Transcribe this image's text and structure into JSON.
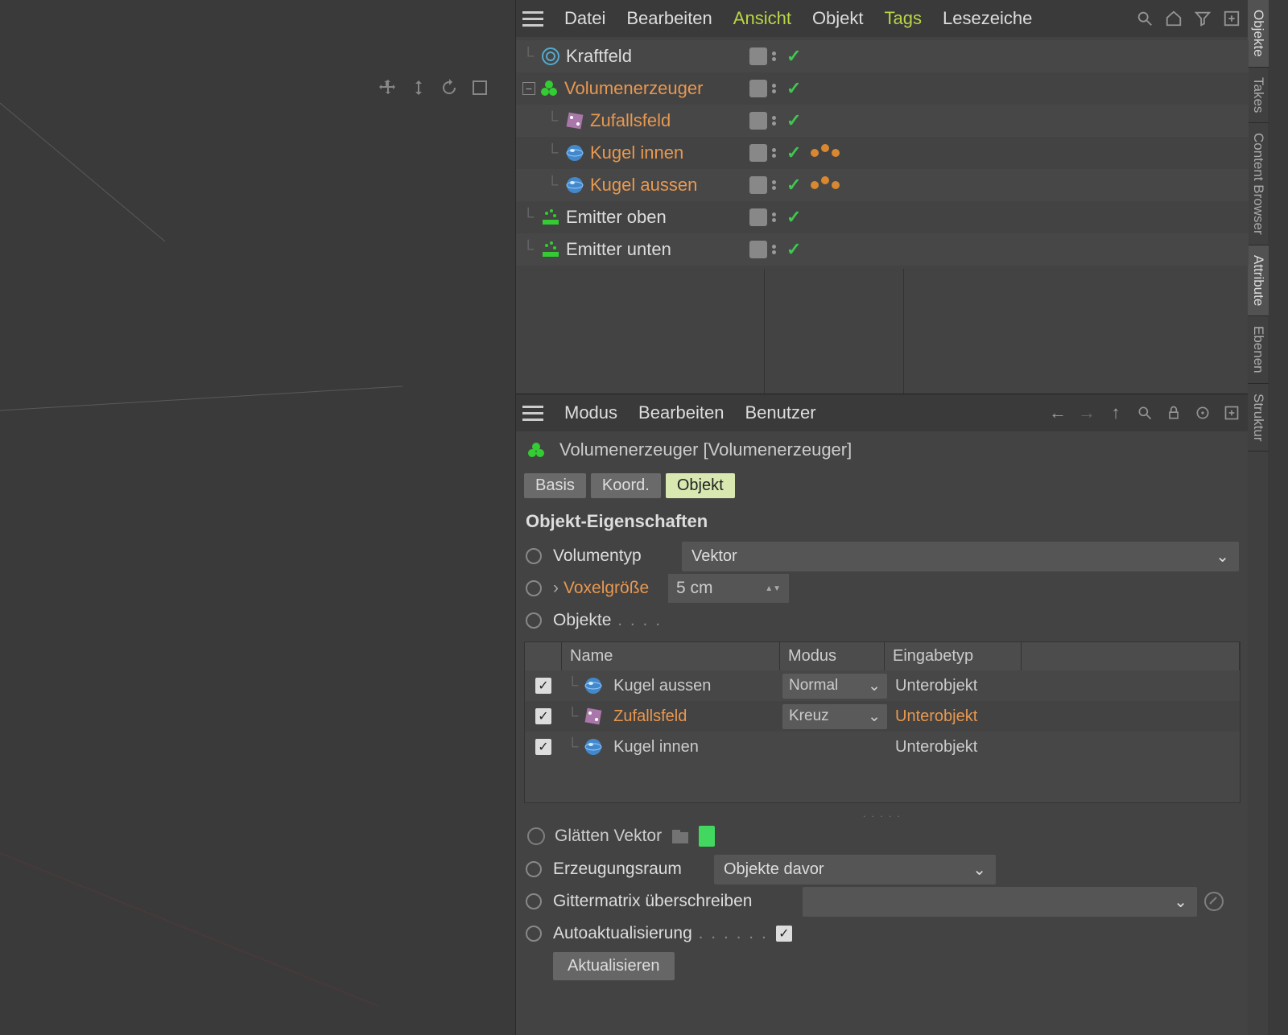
{
  "viewport_tools": [
    "move-icon",
    "updown-icon",
    "rotate-icon",
    "frame-icon"
  ],
  "side_tabs": [
    "Objekte",
    "Takes",
    "Content Browser",
    "Attribute",
    "Ebenen",
    "Struktur"
  ],
  "obj_menu": {
    "items": [
      "Datei",
      "Bearbeiten",
      "Ansicht",
      "Objekt",
      "Tags",
      "Lesezeiche"
    ],
    "highlight": [
      2,
      4
    ],
    "icons": [
      "search-icon",
      "home-icon",
      "filter-icon",
      "add-panel-icon"
    ]
  },
  "tree": [
    {
      "depth": 0,
      "icon": "field-icon",
      "label": "Kraftfeld",
      "cls": "white"
    },
    {
      "depth": 0,
      "icon": "volume-icon",
      "label": "Volumenerzeuger",
      "cls": "orange",
      "expanded": true
    },
    {
      "depth": 1,
      "icon": "random-icon",
      "label": "Zufallsfeld",
      "cls": "orange"
    },
    {
      "depth": 1,
      "icon": "sphere-icon",
      "label": "Kugel innen",
      "cls": "orange",
      "tags": true
    },
    {
      "depth": 1,
      "icon": "sphere-icon",
      "label": "Kugel aussen",
      "cls": "orange",
      "tags": true
    },
    {
      "depth": 0,
      "icon": "emitter-icon",
      "label": "Emitter oben",
      "cls": "white"
    },
    {
      "depth": 0,
      "icon": "emitter-icon",
      "label": "Emitter unten",
      "cls": "white"
    }
  ],
  "attr_menu": {
    "items": [
      "Modus",
      "Bearbeiten",
      "Benutzer"
    ],
    "icons": [
      "back-icon",
      "forward-icon",
      "up-icon",
      "search-icon",
      "lock-icon",
      "target-icon",
      "add-panel-icon"
    ]
  },
  "attr_header": {
    "icon": "volume-icon",
    "title": "Volumenerzeuger [Volumenerzeuger]"
  },
  "tabs": [
    "Basis",
    "Koord.",
    "Objekt"
  ],
  "tabs_active": 2,
  "section_title": "Objekt-Eigenschaften",
  "props": {
    "volumentyp": {
      "label": "Volumentyp",
      "value": "Vektor"
    },
    "voxel": {
      "label": "Voxelgröße",
      "value": "5 cm"
    },
    "objekte": {
      "label": "Objekte"
    },
    "table": {
      "headers": [
        "Name",
        "Modus",
        "Eingabetyp"
      ],
      "rows": [
        {
          "icon": "sphere-icon",
          "name": "Kugel aussen",
          "mode": "Normal",
          "input": "Unterobjekt",
          "orange": false
        },
        {
          "icon": "random-icon",
          "name": "Zufallsfeld",
          "mode": "Kreuz",
          "input": "Unterobjekt",
          "orange": true
        },
        {
          "icon": "sphere-icon",
          "name": "Kugel innen",
          "mode": "",
          "input": "Unterobjekt",
          "orange": false
        }
      ]
    },
    "glatten": {
      "label": "Glätten Vektor"
    },
    "erzeugung": {
      "label": "Erzeugungsraum",
      "value": "Objekte davor"
    },
    "gitter": {
      "label": "Gittermatrix überschreiben"
    },
    "auto": {
      "label": "Autoaktualisierung"
    },
    "aktual_btn": "Aktualisieren"
  }
}
